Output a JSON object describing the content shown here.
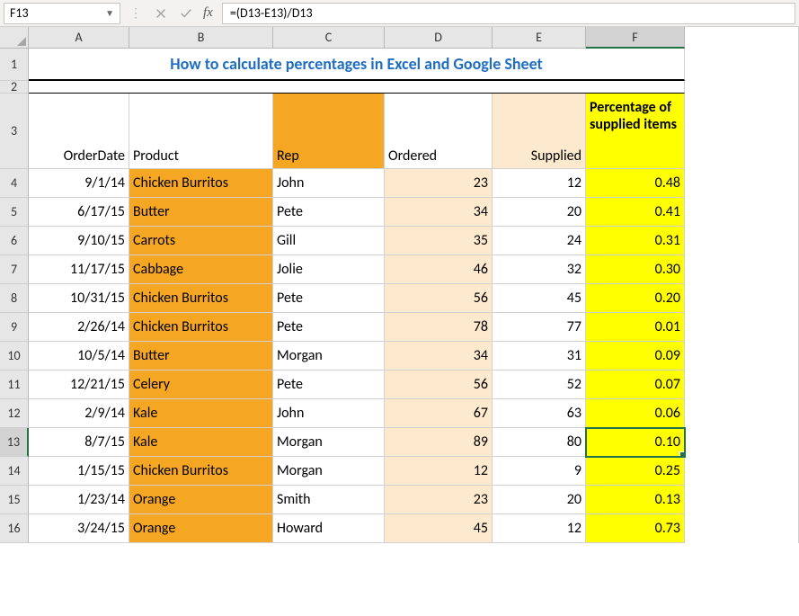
{
  "nameBox": "F13",
  "formula": "=(D13-E13)/D13",
  "columns": [
    "A",
    "B",
    "C",
    "D",
    "E",
    "F"
  ],
  "activeColumn": "F",
  "activeRow": 13,
  "title": "How to calculate percentages in Excel and Google Sheet",
  "headers": {
    "a": "OrderDate",
    "b": "Product",
    "c": "Rep",
    "d": "Ordered",
    "e": "Supplied",
    "f": "Percentage of supplied items"
  },
  "rows": [
    {
      "n": 4,
      "date": "9/1/14",
      "product": "Chicken Burritos",
      "rep": "John",
      "ordered": 23,
      "supplied": 12,
      "pct": "0.48"
    },
    {
      "n": 5,
      "date": "6/17/15",
      "product": "Butter",
      "rep": "Pete",
      "ordered": 34,
      "supplied": 20,
      "pct": "0.41"
    },
    {
      "n": 6,
      "date": "9/10/15",
      "product": "Carrots",
      "rep": "Gill",
      "ordered": 35,
      "supplied": 24,
      "pct": "0.31"
    },
    {
      "n": 7,
      "date": "11/17/15",
      "product": "Cabbage",
      "rep": "Jolie",
      "ordered": 46,
      "supplied": 32,
      "pct": "0.30"
    },
    {
      "n": 8,
      "date": "10/31/15",
      "product": "Chicken Burritos",
      "rep": "Pete",
      "ordered": 56,
      "supplied": 45,
      "pct": "0.20"
    },
    {
      "n": 9,
      "date": "2/26/14",
      "product": "Chicken Burritos",
      "rep": "Pete",
      "ordered": 78,
      "supplied": 77,
      "pct": "0.01"
    },
    {
      "n": 10,
      "date": "10/5/14",
      "product": "Butter",
      "rep": "Morgan",
      "ordered": 34,
      "supplied": 31,
      "pct": "0.09"
    },
    {
      "n": 11,
      "date": "12/21/15",
      "product": "Celery",
      "rep": "Pete",
      "ordered": 56,
      "supplied": 52,
      "pct": "0.07"
    },
    {
      "n": 12,
      "date": "2/9/14",
      "product": "Kale",
      "rep": "John",
      "ordered": 67,
      "supplied": 63,
      "pct": "0.06"
    },
    {
      "n": 13,
      "date": "8/7/15",
      "product": "Kale",
      "rep": "Morgan",
      "ordered": 89,
      "supplied": 80,
      "pct": "0.10"
    },
    {
      "n": 14,
      "date": "1/15/15",
      "product": "Chicken Burritos",
      "rep": "Morgan",
      "ordered": 12,
      "supplied": 9,
      "pct": "0.25"
    },
    {
      "n": 15,
      "date": "1/23/14",
      "product": "Orange",
      "rep": "Smith",
      "ordered": 23,
      "supplied": 20,
      "pct": "0.13"
    },
    {
      "n": 16,
      "date": "3/24/15",
      "product": "Orange",
      "rep": "Howard",
      "ordered": 45,
      "supplied": 12,
      "pct": "0.73"
    }
  ],
  "chart_data": {
    "type": "table",
    "title": "How to calculate percentages in Excel and Google Sheet",
    "columns": [
      "OrderDate",
      "Product",
      "Rep",
      "Ordered",
      "Supplied",
      "Percentage of supplied items"
    ],
    "rows": [
      [
        "9/1/14",
        "Chicken Burritos",
        "John",
        23,
        12,
        0.48
      ],
      [
        "6/17/15",
        "Butter",
        "Pete",
        34,
        20,
        0.41
      ],
      [
        "9/10/15",
        "Carrots",
        "Gill",
        35,
        24,
        0.31
      ],
      [
        "11/17/15",
        "Cabbage",
        "Jolie",
        46,
        32,
        0.3
      ],
      [
        "10/31/15",
        "Chicken Burritos",
        "Pete",
        56,
        45,
        0.2
      ],
      [
        "2/26/14",
        "Chicken Burritos",
        "Pete",
        78,
        77,
        0.01
      ],
      [
        "10/5/14",
        "Butter",
        "Morgan",
        34,
        31,
        0.09
      ],
      [
        "12/21/15",
        "Celery",
        "Pete",
        56,
        52,
        0.07
      ],
      [
        "2/9/14",
        "Kale",
        "John",
        67,
        63,
        0.06
      ],
      [
        "8/7/15",
        "Kale",
        "Morgan",
        89,
        80,
        0.1
      ],
      [
        "1/15/15",
        "Chicken Burritos",
        "Morgan",
        12,
        9,
        0.25
      ],
      [
        "1/23/14",
        "Orange",
        "Smith",
        23,
        20,
        0.13
      ],
      [
        "3/24/15",
        "Orange",
        "Howard",
        45,
        12,
        0.73
      ]
    ]
  }
}
